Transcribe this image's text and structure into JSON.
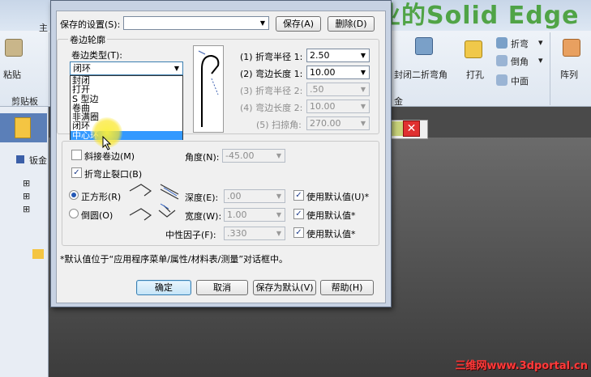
{
  "background": {
    "brand_title": "中国最专业的Solid Edge",
    "ribbon": {
      "paste_label": "粘贴",
      "clipboard_label": "剪贴板",
      "group_label_right": "金",
      "close_bend_label": "封闭二折弯角",
      "punch_label": "打孔",
      "bend_label": "折弯",
      "chamfer_label": "倒角",
      "midplane_label": "中面",
      "array_label": "阵列",
      "tab_main": "主"
    },
    "tree": {
      "root_label": "钣金"
    },
    "watermark": "三维网www.3dportal.cn"
  },
  "colors": {
    "selection": "#3399ff",
    "cancel_red": "#e03030",
    "brand_green": "#3a9a2a",
    "dialog_frame": "#c7d2e3"
  },
  "dialog": {
    "saved_settings_label": "保存的设置(S):",
    "saved_settings_value": "",
    "save_button": "保存(A)",
    "delete_button": "删除(D)",
    "hem_profile_group": "卷边轮廓",
    "hem_type_label": "卷边类型(T):",
    "hem_type_value": "闭环",
    "hem_type_options": [
      "封闭",
      "打开",
      "S 型边",
      "卷曲",
      "非满圈",
      "闭环",
      "中心环"
    ],
    "hem_type_selected_index": 6,
    "params": [
      {
        "label": "(1) 折弯半径 1:",
        "value": "2.50",
        "enabled": true
      },
      {
        "label": "(2) 弯边长度 1:",
        "value": "10.00",
        "enabled": true
      },
      {
        "label": "(3) 折弯半径 2:",
        "value": ".50",
        "enabled": false
      },
      {
        "label": "(4) 弯边长度 2:",
        "value": "10.00",
        "enabled": false
      },
      {
        "label": "(5) 扫掠角:",
        "value": "270.00",
        "enabled": false
      }
    ],
    "miter_hem_label": "斜接卷边(M)",
    "miter_hem_checked": false,
    "angle_label": "角度(N):",
    "angle_value": "-45.00",
    "bend_relief_label": "折弯止裂口(B)",
    "bend_relief_checked": true,
    "square_label": "正方形(R)",
    "round_label": "倒圆(O)",
    "relief_shape_selected": "square",
    "depth_label": "深度(E):",
    "depth_value": ".00",
    "width_label": "宽度(W):",
    "width_value": "1.00",
    "neutral_factor_label": "中性因子(F):",
    "neutral_factor_value": ".330",
    "use_default_1": "使用默认值(U)*",
    "use_default_2": "使用默认值*",
    "use_default_3": "使用默认值*",
    "use_default_checked": [
      true,
      true,
      true
    ],
    "footnote": "*默认值位于“应用程序菜单/属性/材料表/测量”对话框中。",
    "ok_button": "确定",
    "cancel_button": "取消",
    "save_default_button": "保存为默认(V)",
    "help_button": "帮助(H)"
  }
}
